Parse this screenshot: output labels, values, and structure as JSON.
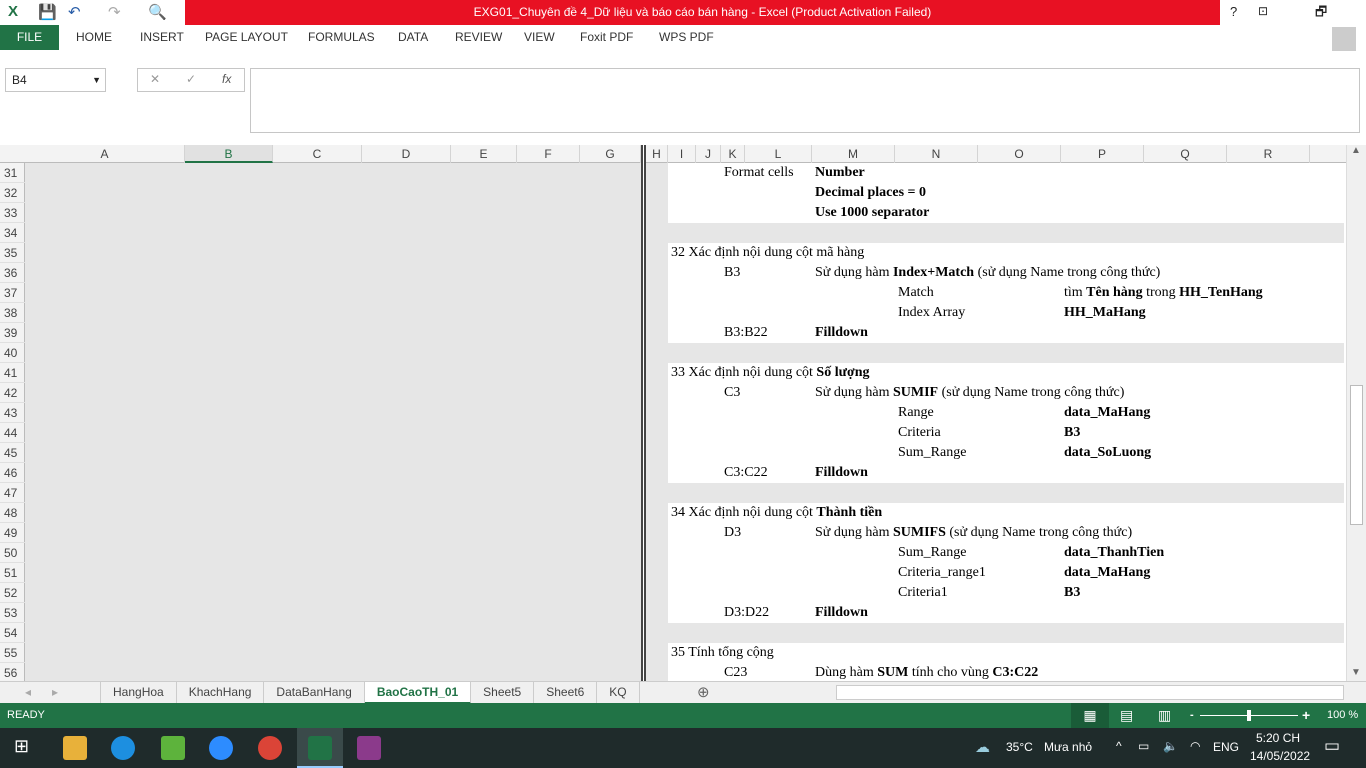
{
  "window": {
    "title": "EXG01_Chuyên đề 4_Dữ liệu và báo cáo bán hàng -  Excel (Product Activation Failed)",
    "help": "?",
    "restore": "🗗",
    "minimize": "—"
  },
  "ribbon": {
    "file": "FILE",
    "tabs": [
      "HOME",
      "INSERT",
      "PAGE LAYOUT",
      "FORMULAS",
      "DATA",
      "REVIEW",
      "VIEW",
      "Foxit PDF",
      "WPS PDF"
    ]
  },
  "formula_bar": {
    "name_box": "B4",
    "cancel": "✕",
    "enter": "✓",
    "fx": "fx",
    "value": ""
  },
  "columns": [
    "A",
    "B",
    "C",
    "D",
    "E",
    "F",
    "G",
    "H",
    "I",
    "J",
    "K",
    "L",
    "M",
    "N",
    "O",
    "P",
    "Q",
    "R"
  ],
  "selected_column": "B",
  "rows": [
    "31",
    "32",
    "33",
    "34",
    "35",
    "36",
    "37",
    "38",
    "39",
    "40",
    "41",
    "42",
    "43",
    "44",
    "45",
    "46",
    "47",
    "48",
    "49",
    "50",
    "51",
    "52",
    "53",
    "54",
    "55",
    "56"
  ],
  "cells": [
    {
      "row": 0,
      "col": "K",
      "seg": [
        {
          "t": "Format cells"
        }
      ]
    },
    {
      "row": 0,
      "col": "M",
      "seg": [
        {
          "t": "Number",
          "b": true
        }
      ]
    },
    {
      "row": 1,
      "col": "M",
      "seg": [
        {
          "t": "Decimal places = 0",
          "b": true
        }
      ]
    },
    {
      "row": 2,
      "col": "M",
      "seg": [
        {
          "t": "Use 1000 separator",
          "b": true
        }
      ]
    },
    {
      "row": 4,
      "col": "I",
      "seg": [
        {
          "t": "32 Xác định nội dung cột mã hàng"
        }
      ]
    },
    {
      "row": 5,
      "col": "K",
      "seg": [
        {
          "t": "B3"
        }
      ]
    },
    {
      "row": 5,
      "col": "M",
      "seg": [
        {
          "t": "Sử dụng hàm "
        },
        {
          "t": "Index+Match",
          "b": true
        },
        {
          "t": " (sử dụng Name trong công thức)"
        }
      ]
    },
    {
      "row": 6,
      "col": "N",
      "seg": [
        {
          "t": "Match"
        }
      ]
    },
    {
      "row": 6,
      "col": "P",
      "seg": [
        {
          "t": "tìm "
        },
        {
          "t": "Tên hàng",
          "b": true
        },
        {
          "t": " trong "
        },
        {
          "t": "HH_TenHang",
          "b": true
        }
      ]
    },
    {
      "row": 7,
      "col": "N",
      "seg": [
        {
          "t": "Index Array"
        }
      ]
    },
    {
      "row": 7,
      "col": "P",
      "seg": [
        {
          "t": "HH_MaHang",
          "b": true
        }
      ]
    },
    {
      "row": 8,
      "col": "K",
      "seg": [
        {
          "t": "B3:B22"
        }
      ]
    },
    {
      "row": 8,
      "col": "M",
      "seg": [
        {
          "t": "Filldown",
          "b": true
        }
      ]
    },
    {
      "row": 10,
      "col": "I",
      "seg": [
        {
          "t": "33 Xác định nội dung cột "
        },
        {
          "t": "Số lượng",
          "b": true
        }
      ]
    },
    {
      "row": 11,
      "col": "K",
      "seg": [
        {
          "t": "C3"
        }
      ]
    },
    {
      "row": 11,
      "col": "M",
      "seg": [
        {
          "t": "Sử dụng hàm "
        },
        {
          "t": "SUMIF",
          "b": true
        },
        {
          "t": " (sử dụng Name trong công thức)"
        }
      ]
    },
    {
      "row": 12,
      "col": "N",
      "seg": [
        {
          "t": "Range"
        }
      ]
    },
    {
      "row": 12,
      "col": "P",
      "seg": [
        {
          "t": "data_MaHang",
          "b": true
        }
      ]
    },
    {
      "row": 13,
      "col": "N",
      "seg": [
        {
          "t": "Criteria"
        }
      ]
    },
    {
      "row": 13,
      "col": "P",
      "seg": [
        {
          "t": "B3",
          "b": true
        }
      ]
    },
    {
      "row": 14,
      "col": "N",
      "seg": [
        {
          "t": "Sum_Range"
        }
      ]
    },
    {
      "row": 14,
      "col": "P",
      "seg": [
        {
          "t": "data_SoLuong",
          "b": true
        }
      ]
    },
    {
      "row": 15,
      "col": "K",
      "seg": [
        {
          "t": "C3:C22"
        }
      ]
    },
    {
      "row": 15,
      "col": "M",
      "seg": [
        {
          "t": "Filldown",
          "b": true
        }
      ]
    },
    {
      "row": 17,
      "col": "I",
      "seg": [
        {
          "t": "34 Xác định nội dung cột "
        },
        {
          "t": "Thành tiền",
          "b": true
        }
      ]
    },
    {
      "row": 18,
      "col": "K",
      "seg": [
        {
          "t": "D3"
        }
      ]
    },
    {
      "row": 18,
      "col": "M",
      "seg": [
        {
          "t": "Sử dụng hàm "
        },
        {
          "t": "SUMIFS",
          "b": true
        },
        {
          "t": " (sử dụng Name trong công thức)"
        }
      ]
    },
    {
      "row": 19,
      "col": "N",
      "seg": [
        {
          "t": "Sum_Range"
        }
      ]
    },
    {
      "row": 19,
      "col": "P",
      "seg": [
        {
          "t": "data_ThanhTien",
          "b": true
        }
      ]
    },
    {
      "row": 20,
      "col": "N",
      "seg": [
        {
          "t": "Criteria_range1"
        }
      ]
    },
    {
      "row": 20,
      "col": "P",
      "seg": [
        {
          "t": "data_MaHang",
          "b": true
        }
      ]
    },
    {
      "row": 21,
      "col": "N",
      "seg": [
        {
          "t": "Criteria1"
        }
      ]
    },
    {
      "row": 21,
      "col": "P",
      "seg": [
        {
          "t": "B3",
          "b": true
        }
      ]
    },
    {
      "row": 22,
      "col": "K",
      "seg": [
        {
          "t": "D3:D22"
        }
      ]
    },
    {
      "row": 22,
      "col": "M",
      "seg": [
        {
          "t": "Filldown",
          "b": true
        }
      ]
    },
    {
      "row": 24,
      "col": "I",
      "seg": [
        {
          "t": "35 Tính tổng cộng"
        }
      ]
    },
    {
      "row": 25,
      "col": "K",
      "seg": [
        {
          "t": "C23"
        }
      ]
    },
    {
      "row": 25,
      "col": "M",
      "seg": [
        {
          "t": "Dùng hàm "
        },
        {
          "t": "SUM",
          "b": true
        },
        {
          "t": " tính cho vùng "
        },
        {
          "t": "C3:C22",
          "b": true
        }
      ]
    }
  ],
  "gray_rows": [
    3,
    9,
    16,
    23
  ],
  "sheets": [
    "HangHoa",
    "KhachHang",
    "DataBanHang",
    "BaoCaoTH_01",
    "Sheet5",
    "Sheet6",
    "KQ"
  ],
  "active_sheet": "BaoCaoTH_01",
  "status": {
    "ready": "READY",
    "zoom": "100 %",
    "zoom_level": 100
  },
  "taskbar": {
    "weather": "35°C",
    "weather_desc": "Mưa nhỏ",
    "lang": "ENG",
    "time": "5:20 CH",
    "date": "14/05/2022"
  },
  "colors": {
    "excel_green": "#217346",
    "title_red": "#e81123"
  }
}
